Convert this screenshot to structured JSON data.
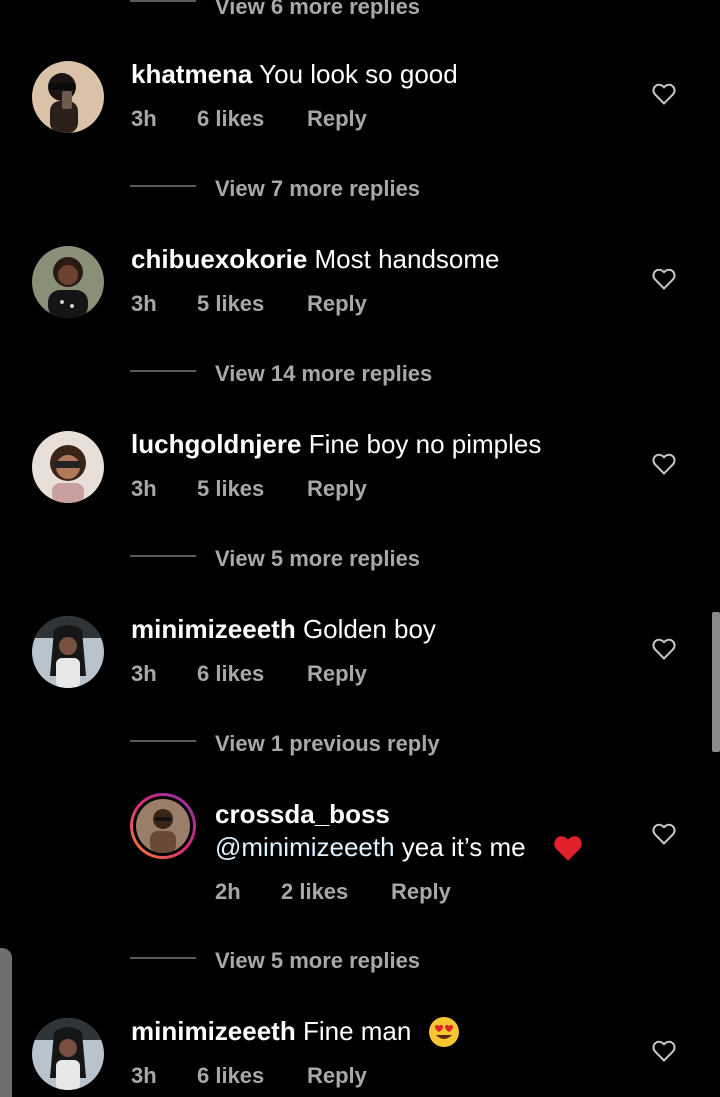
{
  "top_view_replies": "View 6 more replies",
  "comments": [
    {
      "username": "khatmena",
      "text": "You look so good",
      "time": "3h",
      "likes": "6 likes",
      "reply": "Reply",
      "view_replies": "View 7 more replies"
    },
    {
      "username": "chibuexokorie",
      "text": "Most handsome",
      "time": "3h",
      "likes": "5 likes",
      "reply": "Reply",
      "view_replies": "View 14 more replies"
    },
    {
      "username": "luchgoldnjere",
      "text": "Fine boy no pimples",
      "time": "3h",
      "likes": "5 likes",
      "reply": "Reply",
      "view_replies": "View 5 more replies"
    },
    {
      "username": "minimizeeeth",
      "text": "Golden boy",
      "time": "3h",
      "likes": "6 likes",
      "reply": "Reply",
      "view_replies": "View 1 previous reply"
    },
    {
      "username": "minimizeeeth",
      "text": "Fine man",
      "time": "3h",
      "likes": "6 likes",
      "reply": "Reply"
    }
  ],
  "reply": {
    "username": "crossda_boss",
    "mention": "@minimizeeeth",
    "text": "yea it’s me",
    "emoji": "❤️",
    "time": "2h",
    "likes": "2 likes",
    "reply": "Reply",
    "view_replies": "View 5 more replies"
  },
  "last_emoji": "😍",
  "icons": {
    "like": "heart-outline-icon"
  },
  "colors": {
    "bg": "#000000",
    "muted": "#a8a8a8",
    "story_ring_a": "#f58529",
    "story_ring_b": "#dd2a7b",
    "heart_red": "#e0202a"
  }
}
